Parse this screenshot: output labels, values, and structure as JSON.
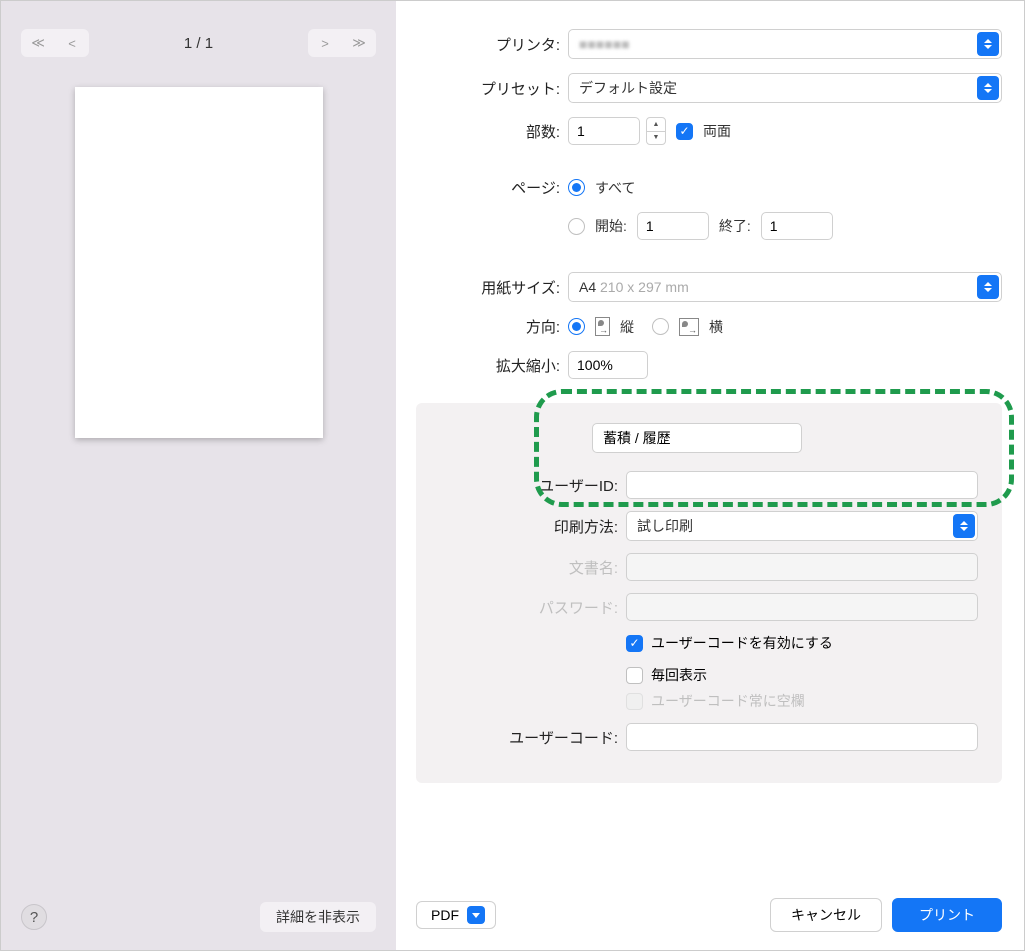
{
  "preview": {
    "page_indicator": "1 / 1",
    "hide_details_label": "詳細を非表示"
  },
  "labels": {
    "printer": "プリンタ:",
    "preset": "プリセット:",
    "copies": "部数:",
    "duplex": "両面",
    "pages": "ページ:",
    "all": "すべて",
    "start": "開始:",
    "end": "終了:",
    "paper_size": "用紙サイズ:",
    "orientation": "方向:",
    "portrait": "縦",
    "landscape": "横",
    "scale": "拡大縮小:"
  },
  "values": {
    "printer_name": "■■■■■■",
    "preset": "デフォルト設定",
    "copies": "1",
    "start": "1",
    "end": "1",
    "paper_size_name": "A4",
    "paper_size_dim": "210 x 297 mm",
    "scale": "100%"
  },
  "panel": {
    "section_name": "蓄積 / 履歴",
    "user_id_label": "ユーザーID:",
    "print_method_label": "印刷方法:",
    "print_method_value": "試し印刷",
    "doc_name_label": "文書名:",
    "password_label": "パスワード:",
    "enable_usercode": "ユーザーコードを有効にする",
    "show_everytime": "毎回表示",
    "usercode_blank": "ユーザーコード常に空欄",
    "user_code_label": "ユーザーコード:"
  },
  "buttons": {
    "pdf": "PDF",
    "cancel": "キャンセル",
    "print": "プリント"
  }
}
